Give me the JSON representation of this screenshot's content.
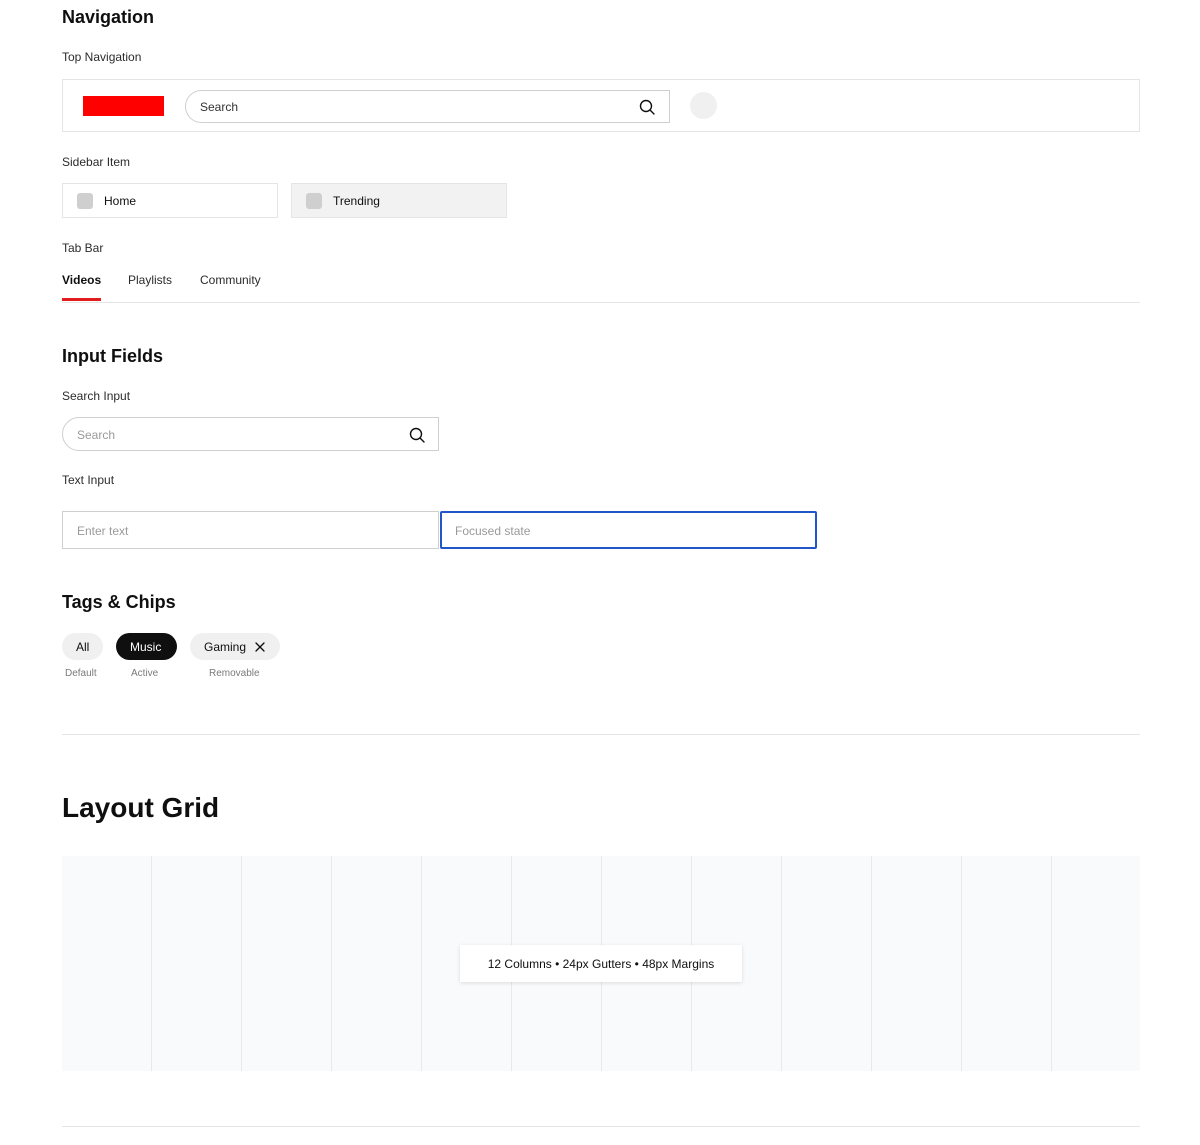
{
  "navigation": {
    "heading": "Navigation",
    "top_nav": {
      "label": "Top Navigation",
      "search_placeholder": "Search",
      "logo_color": "#ff0000"
    },
    "sidebar": {
      "label": "Sidebar Item",
      "items": [
        {
          "label": "Home",
          "active": false
        },
        {
          "label": "Trending",
          "active": true
        }
      ]
    },
    "tab_bar": {
      "label": "Tab Bar",
      "tabs": [
        {
          "label": "Videos",
          "active": true
        },
        {
          "label": "Playlists",
          "active": false
        },
        {
          "label": "Community",
          "active": false
        }
      ],
      "accent": "#e21b1b"
    }
  },
  "input_fields": {
    "heading": "Input Fields",
    "search_input": {
      "label": "Search Input",
      "placeholder": "Search"
    },
    "text_input": {
      "label": "Text Input",
      "default_placeholder": "Enter text",
      "focused_placeholder": "Focused state",
      "focus_color": "#2156c9"
    }
  },
  "tags_chips": {
    "heading": "Tags & Chips",
    "chips": [
      {
        "label": "All",
        "caption": "Default"
      },
      {
        "label": "Music",
        "caption": "Active"
      },
      {
        "label": "Gaming",
        "caption": "Removable",
        "icon": "close-icon"
      }
    ]
  },
  "layout_grid": {
    "heading": "Layout Grid",
    "badge": "12 Columns • 24px Gutters • 48px Margins"
  }
}
